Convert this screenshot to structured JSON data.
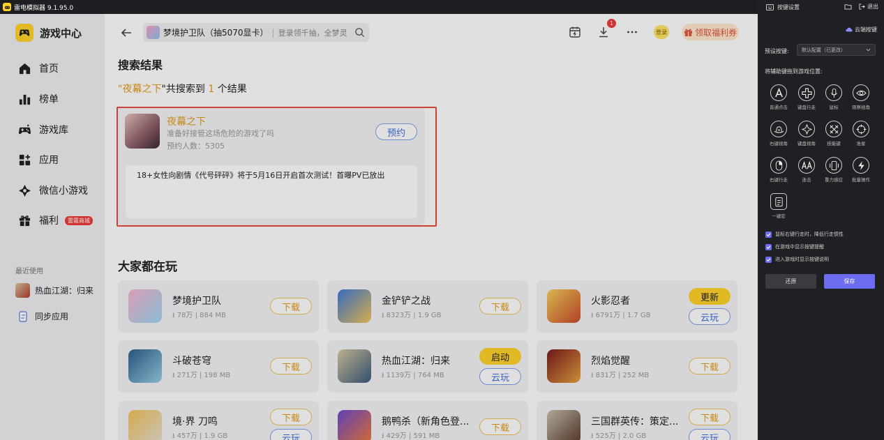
{
  "window": {
    "title": "雷电模拟器 9.1.95.0"
  },
  "sidebar": {
    "brand": "游戏中心",
    "items": [
      {
        "label": "首页",
        "icon": "home-icon"
      },
      {
        "label": "榜单",
        "icon": "chart-icon"
      },
      {
        "label": "游戏库",
        "icon": "gamepad-icon"
      },
      {
        "label": "应用",
        "icon": "apps-icon"
      },
      {
        "label": "微信小游戏",
        "icon": "wechat-game-icon"
      },
      {
        "label": "福利",
        "icon": "gift-icon",
        "badge": "雷霆商城"
      }
    ],
    "recent_title": "最近使用",
    "recent": [
      {
        "label": "热血江湖：归来"
      },
      {
        "label": "同步应用"
      }
    ]
  },
  "topbar": {
    "search_game": "梦境护卫队（抽5070显卡）",
    "search_placeholder": "登录领千抽，全梦灵",
    "notification_count": "1",
    "login_label": "登录",
    "coupon_label": "领取福利券"
  },
  "search_results": {
    "title": "搜索结果",
    "quote_open": "\"",
    "keyword": "夜幕之下",
    "mid_text": "\"共搜索到",
    "count": "1",
    "tail_text": "个结果",
    "card": {
      "name": "夜幕之下",
      "desc": "准备好接管这场危险的游戏了吗",
      "count_text": "预约人数：5305",
      "button": "预约",
      "news": "18+女性向剧情《代号砰砰》将于5月16日开启首次测试！首曝PV已放出"
    }
  },
  "popular": {
    "title": "大家都在玩",
    "games": [
      {
        "name": "梦境护卫队",
        "meta": "⭳ 78万 | 884 MB",
        "buttons": [
          "下载"
        ],
        "colors": [
          "#f6b4cf",
          "#9fd7f3"
        ]
      },
      {
        "name": "金铲铲之战",
        "meta": "⭳ 8323万 | 1.9 GB",
        "buttons": [
          "下载"
        ],
        "colors": [
          "#3e7ad8",
          "#f2c55a"
        ]
      },
      {
        "name": "火影忍者",
        "meta": "⭳ 6791万 | 1.7 GB",
        "buttons": [
          "更新",
          "云玩"
        ],
        "colors": [
          "#f7d05a",
          "#c94a2c"
        ]
      },
      {
        "name": "斗破苍穹",
        "meta": "⭳ 271万 | 198 MB",
        "buttons": [
          "下载"
        ],
        "colors": [
          "#2d5f8a",
          "#9ad0e8"
        ]
      },
      {
        "name": "热血江湖：归来",
        "meta": "⭳ 1139万 | 764 MB",
        "buttons": [
          "启动",
          "云玩"
        ],
        "colors": [
          "#d9c9a2",
          "#3a5a7c"
        ]
      },
      {
        "name": "烈焰觉醒",
        "meta": "⭳ 831万 | 252 MB",
        "buttons": [
          "下载"
        ],
        "colors": [
          "#7a1c1c",
          "#e8a040"
        ]
      },
      {
        "name": "境·界 刀鸣",
        "meta": "⭳ 457万 | 1.9 GB",
        "buttons": [
          "下载",
          "云玩"
        ],
        "colors": [
          "#f2c25a",
          "#e8e0d0"
        ]
      },
      {
        "name": "鹅鸭杀（新角色登...",
        "meta": "⭳ 429万 | 591 MB",
        "buttons": [
          "下载"
        ],
        "colors": [
          "#6a4ad0",
          "#f27a3a"
        ]
      },
      {
        "name": "三国群英传：策定...",
        "meta": "⭳ 525万 | 2.0 GB",
        "buttons": [
          "下载",
          "云玩"
        ],
        "colors": [
          "#c8c0b0",
          "#5a3a2a"
        ]
      }
    ]
  },
  "key_panel": {
    "title": "按键设置",
    "exit_label": "退出",
    "cloud_key": "云端按键",
    "preset_label": "预设按键:",
    "preset_value": "默认配置（已更改）",
    "drag_label": "将辅助键拖到游戏位置:",
    "keys": [
      {
        "label": "普通点击",
        "icon": "letter-a-icon"
      },
      {
        "label": "键盘行走",
        "icon": "dpad-icon"
      },
      {
        "label": "鼠标",
        "icon": "mic-icon"
      },
      {
        "label": "观察视角",
        "icon": "eye-icon"
      },
      {
        "label": "右键视角",
        "icon": "hat-icon"
      },
      {
        "label": "键盘视角",
        "icon": "compass-icon"
      },
      {
        "label": "技能键",
        "icon": "swords-icon"
      },
      {
        "label": "准星",
        "icon": "crosshair-icon"
      },
      {
        "label": "右键行走",
        "icon": "mouse-icon"
      },
      {
        "label": "连击",
        "icon": "double-a-icon"
      },
      {
        "label": "重力感应",
        "icon": "phone-tilt-icon"
      },
      {
        "label": "批量操作",
        "icon": "lightning-icon"
      },
      {
        "label": "一键宏",
        "icon": "macro-icon"
      }
    ],
    "checkboxes": [
      "鼠标右键行走时，降低行走惯性",
      "在游戏中显示按键提醒",
      "进入游戏时显示按键说明"
    ],
    "reset_label": "还原",
    "save_label": "保存",
    "colors": {
      "save": "#6c6cf0",
      "reset": "#3a3b40"
    }
  }
}
